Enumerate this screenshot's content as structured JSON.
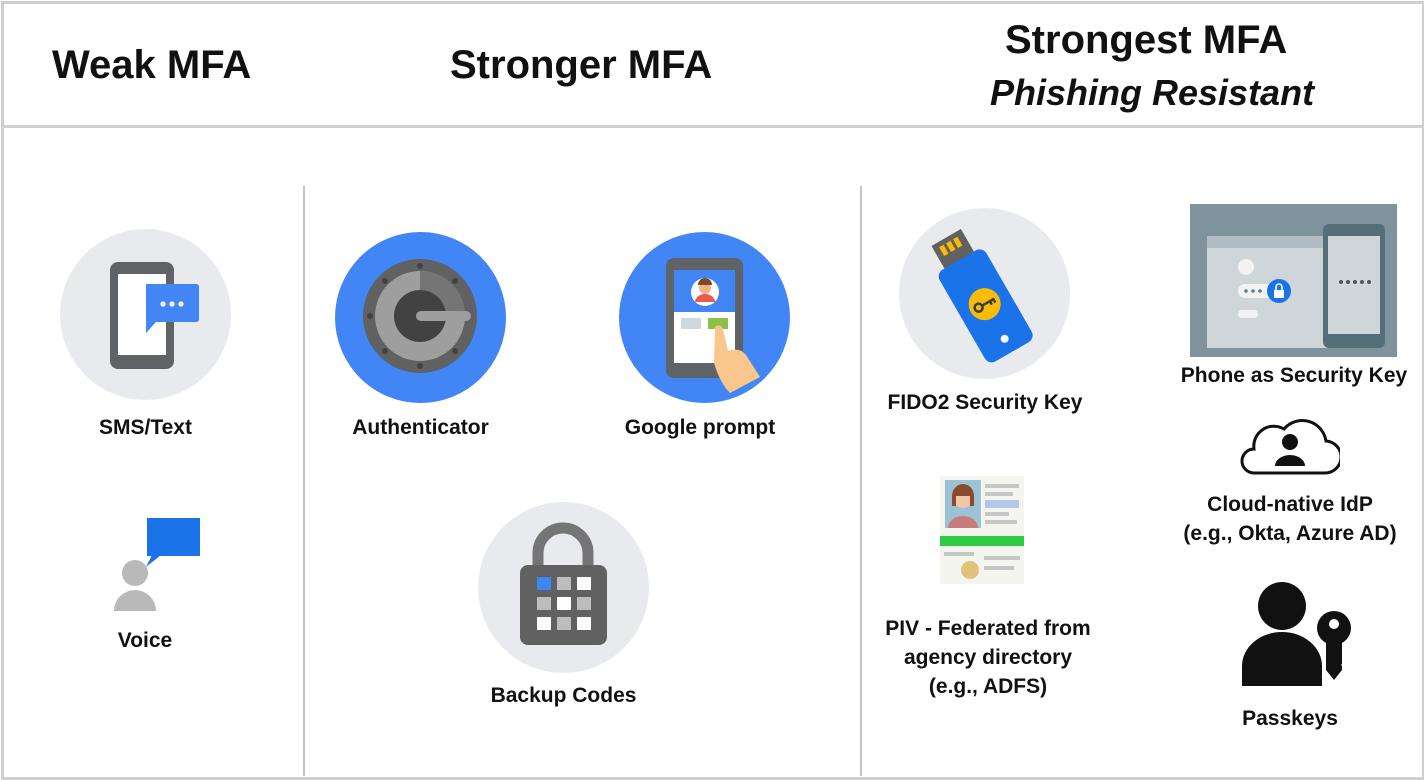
{
  "headers": {
    "weak": "Weak MFA",
    "stronger": "Stronger MFA",
    "strongest": "Strongest MFA",
    "strongest_sub": "Phishing Resistant"
  },
  "weak": {
    "sms_label": "SMS/Text",
    "voice_label": "Voice"
  },
  "stronger": {
    "authenticator_label": "Authenticator",
    "google_prompt_label": "Google prompt",
    "backup_codes_label": "Backup Codes"
  },
  "strongest": {
    "fido2_label": "FIDO2 Security Key",
    "phone_key_label": "Phone as Security Key",
    "cloud_idp_label_1": "Cloud-native IdP",
    "cloud_idp_label_2": "(e.g., Okta, Azure AD)",
    "piv_label_1": "PIV - Federated from",
    "piv_label_2": "agency directory",
    "piv_label_3": "(e.g., ADFS)",
    "passkeys_label": "Passkeys"
  },
  "colors": {
    "google_blue": "#4285f4",
    "light_circle": "#e8eaed",
    "divider": "#c4c4c4"
  }
}
